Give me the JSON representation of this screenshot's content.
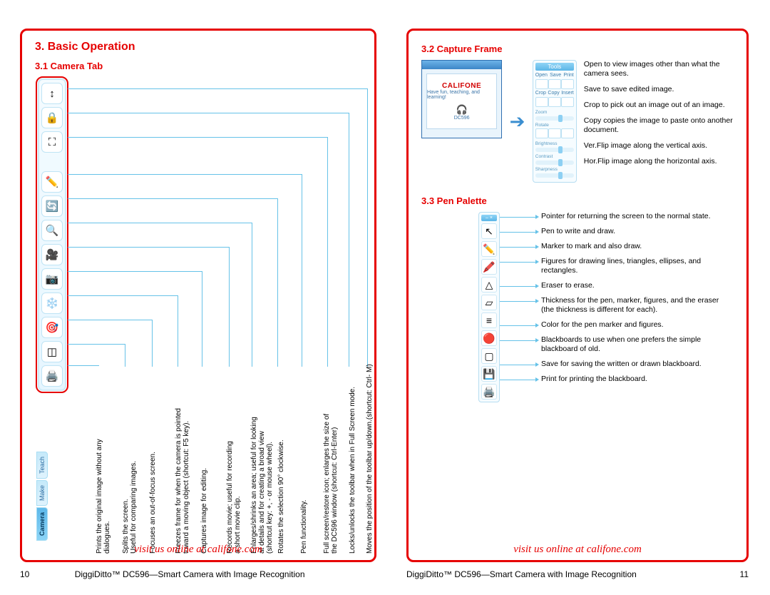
{
  "left": {
    "h3": "3.   Basic Operation",
    "h4": "3.1   Camera Tab",
    "visit": "visit us online at califone.com",
    "tabs": {
      "camera": "Camera",
      "make": "Make",
      "teach": "Teach"
    },
    "labels": [
      "Prints the original image without any\ndialogues.",
      "Splits the screen.\nUseful for comparing images.",
      "Focuses an out-of-focus screen.",
      "Freezes frame for when the camera is pointed\ntoward a moving object (shortcut: F5 key).",
      "Captures image for editing.",
      "Records movie; useful for recording\na short movie clip.",
      "Enlarges/shrinks an area; useful for looking\nat details and for creating a broad view\n(shortcut key: +, - or mouse wheel).",
      "Rotates the selection 90° clockwise.",
      "Pen functionality.",
      "Full screen/restore icon; enlarges the size of\nthe DC596 window (shortcut: Ctrl-Enter)",
      "Locks/unlocks the toolbar when in Full Screen mode.",
      "Moves the position of the toolbar up/down.(shortcut: Ctrl- M)"
    ]
  },
  "right": {
    "h4a": "3.2   Capture Frame",
    "tools_title": "Tools",
    "tool_labels": {
      "open": "Open",
      "save": "Save",
      "print": "Print",
      "crop": "Crop",
      "copy": "Copy",
      "insert": "Insert",
      "zoom": "Zoom",
      "rotate": "Rotate",
      "brightness": "Brightness",
      "contrast": "Contrast",
      "sharpness": "Sharpness"
    },
    "capture_desc": [
      "Open to view images other than what the camera sees.",
      "Save to save edited image.",
      "Crop to pick out an image out of an image.",
      "Copy copies the image to paste onto another document.",
      "Ver.Flip image along the vertical axis.",
      "Hor.Flip image along the horizontal axis."
    ],
    "h4b": "3.3   Pen Palette",
    "pen_desc": [
      "Pointer for returning the screen to the normal state.",
      "Pen to write and draw.",
      "Marker to mark and also draw.",
      "Figures for drawing lines, triangles, ellipses, and rectangles.",
      "Eraser to erase.",
      "Thickness for the pen, marker, figures, and the eraser (the thickness is different for each).",
      "Color for the pen marker and figures.",
      "Blackboards to use when one prefers the simple blackboard of old.",
      "Save for saving the written or drawn blackboard.",
      "Print for printing the blackboard."
    ],
    "visit": "visit us online at califone.com"
  },
  "footer": {
    "left_page": "10",
    "right_page": "11",
    "title": "DiggiDitto™  DC596—Smart Camera with Image Recognition"
  },
  "preview": {
    "brand": "CALIFONE",
    "tag": "Have fun, teaching, and learning!",
    "model": "DC596"
  }
}
